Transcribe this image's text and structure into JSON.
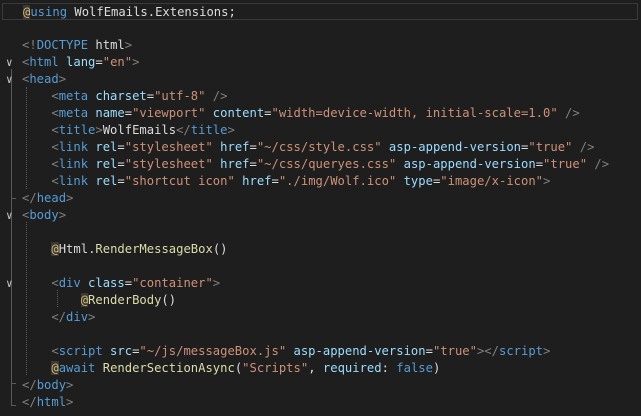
{
  "editor": {
    "lines": [
      [
        {
          "t": "@",
          "c": "t-at"
        },
        {
          "t": "using ",
          "c": "t-kw"
        },
        {
          "t": "WolfEmails.Extensions;",
          "c": "t-text"
        }
      ],
      [],
      [
        {
          "t": "<!",
          "c": "t-punct"
        },
        {
          "t": "DOCTYPE",
          "c": "t-doctype"
        },
        {
          "t": " html",
          "c": "t-text"
        },
        {
          "t": ">",
          "c": "t-punct"
        }
      ],
      [
        {
          "t": "<",
          "c": "t-punct"
        },
        {
          "t": "html",
          "c": "t-tag"
        },
        {
          "t": " lang",
          "c": "t-attr"
        },
        {
          "t": "=",
          "c": "t-text"
        },
        {
          "t": "\"en\"",
          "c": "t-str"
        },
        {
          "t": ">",
          "c": "t-punct"
        }
      ],
      [
        {
          "t": "<",
          "c": "t-punct"
        },
        {
          "t": "head",
          "c": "t-tag"
        },
        {
          "t": ">",
          "c": "t-punct"
        }
      ],
      [
        {
          "t": "    <",
          "c": "t-punct"
        },
        {
          "t": "meta",
          "c": "t-tag"
        },
        {
          "t": " charset",
          "c": "t-attr"
        },
        {
          "t": "=",
          "c": "t-text"
        },
        {
          "t": "\"utf-8\"",
          "c": "t-str"
        },
        {
          "t": " />",
          "c": "t-punct"
        }
      ],
      [
        {
          "t": "    <",
          "c": "t-punct"
        },
        {
          "t": "meta",
          "c": "t-tag"
        },
        {
          "t": " name",
          "c": "t-attr"
        },
        {
          "t": "=",
          "c": "t-text"
        },
        {
          "t": "\"viewport\"",
          "c": "t-str"
        },
        {
          "t": " content",
          "c": "t-attr"
        },
        {
          "t": "=",
          "c": "t-text"
        },
        {
          "t": "\"width=device-width, initial-scale=1.0\"",
          "c": "t-str"
        },
        {
          "t": " />",
          "c": "t-punct"
        }
      ],
      [
        {
          "t": "    <",
          "c": "t-punct"
        },
        {
          "t": "title",
          "c": "t-tag"
        },
        {
          "t": ">",
          "c": "t-punct"
        },
        {
          "t": "WolfEmails",
          "c": "t-text"
        },
        {
          "t": "</",
          "c": "t-punct"
        },
        {
          "t": "title",
          "c": "t-tag"
        },
        {
          "t": ">",
          "c": "t-punct"
        }
      ],
      [
        {
          "t": "    <",
          "c": "t-punct"
        },
        {
          "t": "link",
          "c": "t-tag"
        },
        {
          "t": " rel",
          "c": "t-attr"
        },
        {
          "t": "=",
          "c": "t-text"
        },
        {
          "t": "\"stylesheet\"",
          "c": "t-str"
        },
        {
          "t": " href",
          "c": "t-attr"
        },
        {
          "t": "=",
          "c": "t-text"
        },
        {
          "t": "\"~/css/style.css\"",
          "c": "t-str"
        },
        {
          "t": " asp-append-version",
          "c": "t-attr"
        },
        {
          "t": "=",
          "c": "t-text"
        },
        {
          "t": "\"true\"",
          "c": "t-str"
        },
        {
          "t": " />",
          "c": "t-punct"
        }
      ],
      [
        {
          "t": "    <",
          "c": "t-punct"
        },
        {
          "t": "link",
          "c": "t-tag"
        },
        {
          "t": " rel",
          "c": "t-attr"
        },
        {
          "t": "=",
          "c": "t-text"
        },
        {
          "t": "\"stylesheet\"",
          "c": "t-str"
        },
        {
          "t": " href",
          "c": "t-attr"
        },
        {
          "t": "=",
          "c": "t-text"
        },
        {
          "t": "\"~/css/queryes.css\"",
          "c": "t-str"
        },
        {
          "t": " asp-append-version",
          "c": "t-attr"
        },
        {
          "t": "=",
          "c": "t-text"
        },
        {
          "t": "\"true\"",
          "c": "t-str"
        },
        {
          "t": " />",
          "c": "t-punct"
        }
      ],
      [
        {
          "t": "    <",
          "c": "t-punct"
        },
        {
          "t": "link",
          "c": "t-tag"
        },
        {
          "t": " rel",
          "c": "t-attr"
        },
        {
          "t": "=",
          "c": "t-text"
        },
        {
          "t": "\"shortcut icon\"",
          "c": "t-str"
        },
        {
          "t": " href",
          "c": "t-attr"
        },
        {
          "t": "=",
          "c": "t-text"
        },
        {
          "t": "\"./img/Wolf.ico\"",
          "c": "t-str"
        },
        {
          "t": " type",
          "c": "t-attr"
        },
        {
          "t": "=",
          "c": "t-text"
        },
        {
          "t": "\"image/x-icon\"",
          "c": "t-str"
        },
        {
          "t": ">",
          "c": "t-punct"
        }
      ],
      [
        {
          "t": "</",
          "c": "t-punct"
        },
        {
          "t": "head",
          "c": "t-tag"
        },
        {
          "t": ">",
          "c": "t-punct"
        }
      ],
      [
        {
          "t": "<",
          "c": "t-punct"
        },
        {
          "t": "body",
          "c": "t-tag"
        },
        {
          "t": ">",
          "c": "t-punct"
        }
      ],
      [],
      [
        {
          "t": "    ",
          "c": "t-text"
        },
        {
          "t": "@",
          "c": "t-at"
        },
        {
          "t": "Html",
          "c": "t-text"
        },
        {
          "t": ".",
          "c": "t-text"
        },
        {
          "t": "RenderMessageBox",
          "c": "t-method"
        },
        {
          "t": "()",
          "c": "t-text"
        }
      ],
      [],
      [
        {
          "t": "    <",
          "c": "t-punct"
        },
        {
          "t": "div",
          "c": "t-tag"
        },
        {
          "t": " class",
          "c": "t-attr"
        },
        {
          "t": "=",
          "c": "t-text"
        },
        {
          "t": "\"container\"",
          "c": "t-str"
        },
        {
          "t": ">",
          "c": "t-punct"
        }
      ],
      [
        {
          "t": "        ",
          "c": "t-text"
        },
        {
          "t": "@",
          "c": "t-at"
        },
        {
          "t": "RenderBody",
          "c": "t-method"
        },
        {
          "t": "()",
          "c": "t-text"
        }
      ],
      [
        {
          "t": "    </",
          "c": "t-punct"
        },
        {
          "t": "div",
          "c": "t-tag"
        },
        {
          "t": ">",
          "c": "t-punct"
        }
      ],
      [],
      [
        {
          "t": "    <",
          "c": "t-punct"
        },
        {
          "t": "script",
          "c": "t-tag"
        },
        {
          "t": " src",
          "c": "t-attr"
        },
        {
          "t": "=",
          "c": "t-text"
        },
        {
          "t": "\"~/js/messageBox.js\"",
          "c": "t-str"
        },
        {
          "t": " asp-append-version",
          "c": "t-attr"
        },
        {
          "t": "=",
          "c": "t-text"
        },
        {
          "t": "\"true\"",
          "c": "t-str"
        },
        {
          "t": "></",
          "c": "t-punct"
        },
        {
          "t": "script",
          "c": "t-tag"
        },
        {
          "t": ">",
          "c": "t-punct"
        }
      ],
      [
        {
          "t": "    ",
          "c": "t-text"
        },
        {
          "t": "@",
          "c": "t-at"
        },
        {
          "t": "await",
          "c": "t-kw"
        },
        {
          "t": " RenderSectionAsync",
          "c": "t-method"
        },
        {
          "t": "(",
          "c": "t-text"
        },
        {
          "t": "\"Scripts\"",
          "c": "t-str"
        },
        {
          "t": ", ",
          "c": "t-text"
        },
        {
          "t": "required",
          "c": "t-param"
        },
        {
          "t": ": ",
          "c": "t-text"
        },
        {
          "t": "false",
          "c": "t-kw"
        },
        {
          "t": ")",
          "c": "t-text"
        }
      ],
      [
        {
          "t": "</",
          "c": "t-punct"
        },
        {
          "t": "body",
          "c": "t-tag"
        },
        {
          "t": ">",
          "c": "t-punct"
        }
      ],
      [
        {
          "t": "</",
          "c": "t-punct"
        },
        {
          "t": "html",
          "c": "t-tag"
        },
        {
          "t": ">",
          "c": "t-punct"
        }
      ]
    ],
    "fold_markers": [
      "",
      "",
      "",
      "∨",
      "∨",
      "",
      "",
      "",
      "",
      "",
      "",
      "",
      "∨",
      "",
      "",
      "",
      "∨",
      "",
      "",
      "",
      "",
      "",
      "",
      ""
    ],
    "current_line": 0
  }
}
